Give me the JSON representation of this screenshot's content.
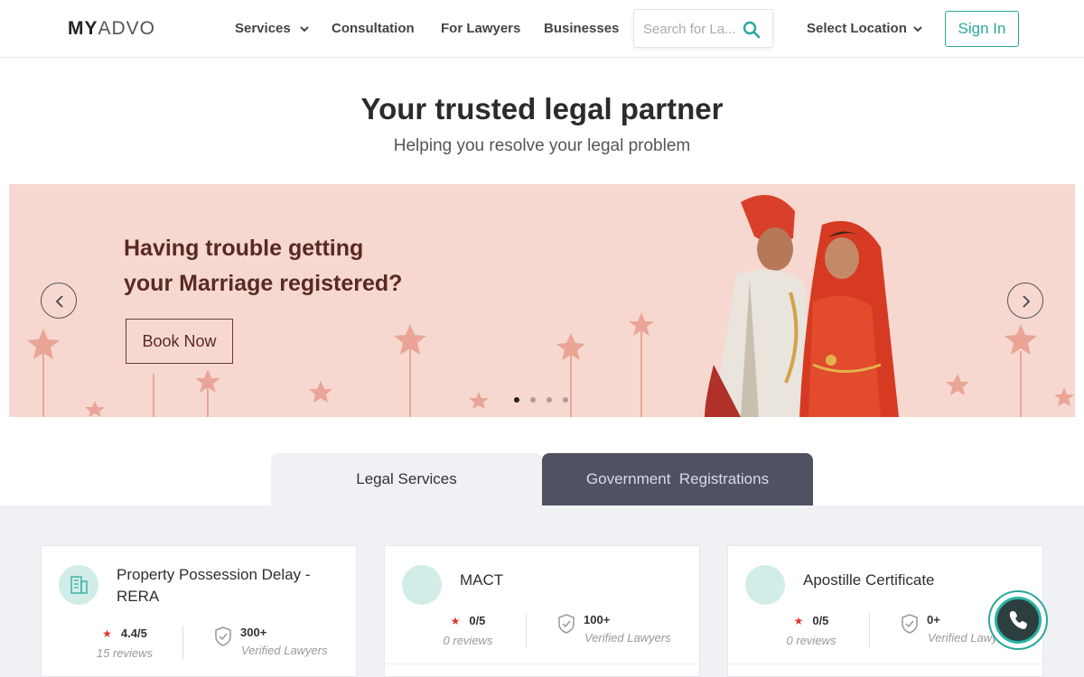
{
  "header": {
    "logo_main": "MY",
    "logo_light": "ADVO",
    "nav": [
      "Services",
      "Consultation",
      "For Lawyers",
      "Businesses"
    ],
    "search_placeholder": "Search for La...",
    "location_label": "Select Location",
    "signin_label": "Sign In"
  },
  "hero": {
    "title": "Your trusted legal partner",
    "subtitle": "Helping you resolve your legal problem"
  },
  "banner": {
    "line1": "Having trouble getting",
    "line2": "your Marriage registered?",
    "cta": "Book Now",
    "slide_count": 4,
    "active_slide": 1,
    "bg_color": "#f6d8d0"
  },
  "tabs": {
    "legal": "Legal Services",
    "gov": "Government  Registrations",
    "active": "gov"
  },
  "services": [
    {
      "title": "Property Possession Delay - RERA",
      "rating": "4.4/5",
      "reviews": "15 reviews",
      "lawyers": "300+",
      "lawyers_label": "Verified Lawyers"
    },
    {
      "title": "MACT",
      "rating": "0/5",
      "reviews": "0 reviews",
      "lawyers": "100+",
      "lawyers_label": "Verified Lawyers"
    },
    {
      "title": "Apostille Certificate",
      "rating": "0/5",
      "reviews": "0 reviews",
      "lawyers": "0+",
      "lawyers_label": "Verified Lawyers"
    }
  ],
  "colors": {
    "accent": "#2aa89a",
    "tab_dark": "#4f5263",
    "section_bg": "#f0f1f5"
  }
}
